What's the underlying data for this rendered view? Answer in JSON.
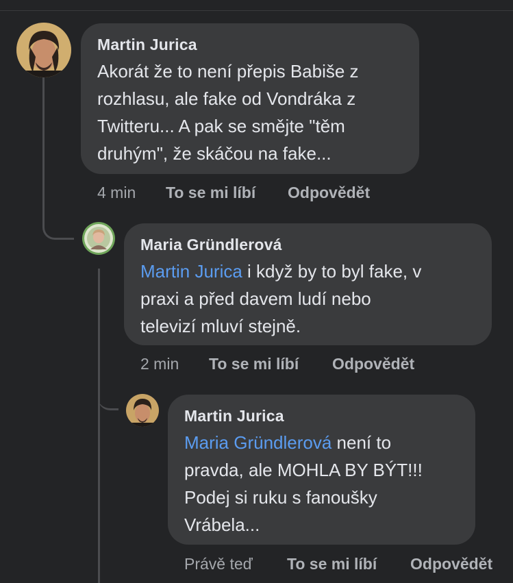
{
  "comments": [
    {
      "author": "Martin Jurica",
      "text_lines": [
        "Akorát že to není přepis Babiše z",
        "rozhlasu, ale fake od Vondráka z",
        "Twitteru... A pak se smějte \"těm",
        "druhým\", že skáčou na fake..."
      ],
      "mention": "",
      "time": "4 min",
      "like_label": "To se mi líbí",
      "reply_label": "Odpovědět"
    },
    {
      "author": "Maria Gründlerová",
      "mention": "Martin Jurica",
      "first_line_rest": " i když by to byl fake, v",
      "text_lines": [
        "praxi a před davem ludí nebo",
        "televizí mluví stejně."
      ],
      "time": "2 min",
      "like_label": "To se mi líbí",
      "reply_label": "Odpovědět"
    },
    {
      "author": "Martin Jurica",
      "mention": "Maria Gründlerová",
      "first_line_rest": " není to",
      "text_lines": [
        "pravda, ale MOHLA BY BÝT!!!",
        "Podej si ruku s fanoušky",
        "Vrábela..."
      ],
      "time": "Právě teď",
      "like_label": "To se mi líbí",
      "reply_label": "Odpovědět"
    }
  ],
  "colors": {
    "background": "#232426",
    "bubble": "#3a3b3d",
    "text": "#e4e6eb",
    "mention": "#5b9cf0",
    "secondary": "#b0b3b8"
  }
}
